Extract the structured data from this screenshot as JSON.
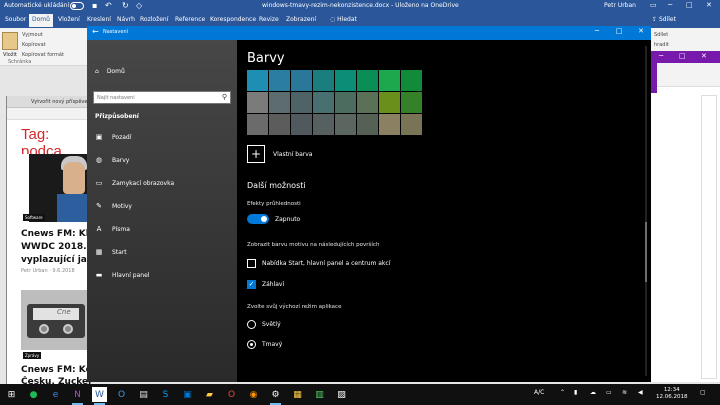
{
  "word": {
    "autosave_label": "Automatické ukládání",
    "document_title": "windows-tmavy-rezim-nekonzistence.docx  -  Uloženo na OneDrive",
    "user_name": "Petr Urban",
    "tabs": [
      "Soubor",
      "Domů",
      "Vložení",
      "Kreslení",
      "Návrh",
      "Rozložení",
      "Reference",
      "Korespondence",
      "Revize",
      "Zobrazení"
    ],
    "search_label": "Hledat",
    "share_label": "Sdílet",
    "ribbon": {
      "paste_label": "Vložit",
      "cut_label": "Vyjmout",
      "copy_label": "Kopírovat",
      "format_painter_label": "Kopírovat formát",
      "clipboard_group": "Schránka",
      "right_share": "Sdílet",
      "right_label": "hradit"
    }
  },
  "browser": {
    "tab_label": "Vytvořit nový příspěve",
    "tag_heading": "Tag: podca",
    "badge1": "Software",
    "badge2": "Zprávy",
    "article1_line1": "Cnews FM: Klí",
    "article1_line2": "WWDC 2018. Z",
    "article1_line3": "vyplazující jazy",
    "article1_meta": "Petr Urban  ·  9.6.2018",
    "thumb2_text": "Cne",
    "article2_line1": "Cnews FM: Kel",
    "article2_line2": "Česku, Zucker"
  },
  "settings": {
    "window_title": "Nastavení",
    "nav": {
      "home": "Domů",
      "search_placeholder": "Najít nastavení",
      "section": "Přizpůsobení",
      "items": [
        "Pozadí",
        "Barvy",
        "Zamykací obrazovka",
        "Motivy",
        "Písma",
        "Start",
        "Hlavní panel"
      ]
    },
    "main": {
      "heading": "Barvy",
      "palette": [
        "#1e8fb3",
        "#2c7ea1",
        "#297799",
        "#1a7e7e",
        "#0b8d77",
        "#0b8e56",
        "#1ea84e",
        "#118a3a",
        "#7b7b7b",
        "#5d6c6e",
        "#4f6265",
        "#497070",
        "#4b6c5e",
        "#5a7057",
        "#6a8f1a",
        "#358129",
        "#6b6b6b",
        "#5c5c5c",
        "#505a5e",
        "#566060",
        "#5c6660",
        "#566156",
        "#8b8162",
        "#7a7456"
      ],
      "custom_color": "Vlastní barva",
      "more_options": "Další možnosti",
      "transparency_label": "Efekty průhlednosti",
      "transparency_value": "Zapnuto",
      "surfaces_label": "Zobrazit barvu motivu na následujících površích",
      "check_start": "Nabídka Start, hlavní panel a centrum akcí",
      "check_titlebars": "Záhlaví",
      "mode_label": "Zvolte svůj výchozí režim aplikace",
      "radio_light": "Světlý",
      "radio_dark": "Tmavý"
    }
  },
  "taskbar": {
    "lang": "A/C",
    "time": "12:34",
    "date": "12.06.2018"
  }
}
